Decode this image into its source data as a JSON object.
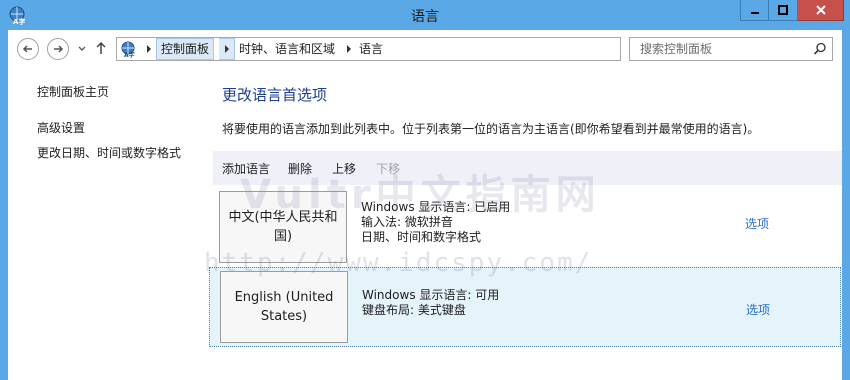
{
  "window": {
    "title": "语言"
  },
  "nav": {
    "breadcrumb": [
      "控制面板",
      "时钟、语言和区域",
      "语言"
    ],
    "search_placeholder": "搜索控制面板"
  },
  "sidebar": {
    "items": [
      {
        "label": "控制面板主页"
      },
      {
        "label": "高级设置"
      },
      {
        "label": "更改日期、时间或数字格式"
      }
    ]
  },
  "main": {
    "title": "更改语言首选项",
    "description": "将要使用的语言添加到此列表中。位于列表第一位的语言为主语言(即你希望看到并最常使用的语言)。",
    "toolbar": {
      "add": "添加语言",
      "remove": "删除",
      "move_up": "上移",
      "move_down": "下移"
    },
    "languages": [
      {
        "name": "中文(中华人民共和国)",
        "details": [
          "Windows 显示语言: 已启用",
          "输入法: 微软拼音",
          "日期、时间和数字格式"
        ],
        "options": "选项"
      },
      {
        "name": "English (United States)",
        "details": [
          "Windows 显示语言: 可用",
          "键盘布局: 美式键盘"
        ],
        "options": "选项"
      }
    ]
  },
  "watermark": {
    "line1": "Vultr中文指南网",
    "line2": "http://www.idcspy.com/"
  },
  "colors": {
    "titlebar": "#5aa9e6",
    "close_button": "#c7504b",
    "page_title": "#1e3f8f",
    "link": "#2a6fc9",
    "toolbar_bg": "#eff0f8",
    "selected_row": "#e5f3fb"
  }
}
